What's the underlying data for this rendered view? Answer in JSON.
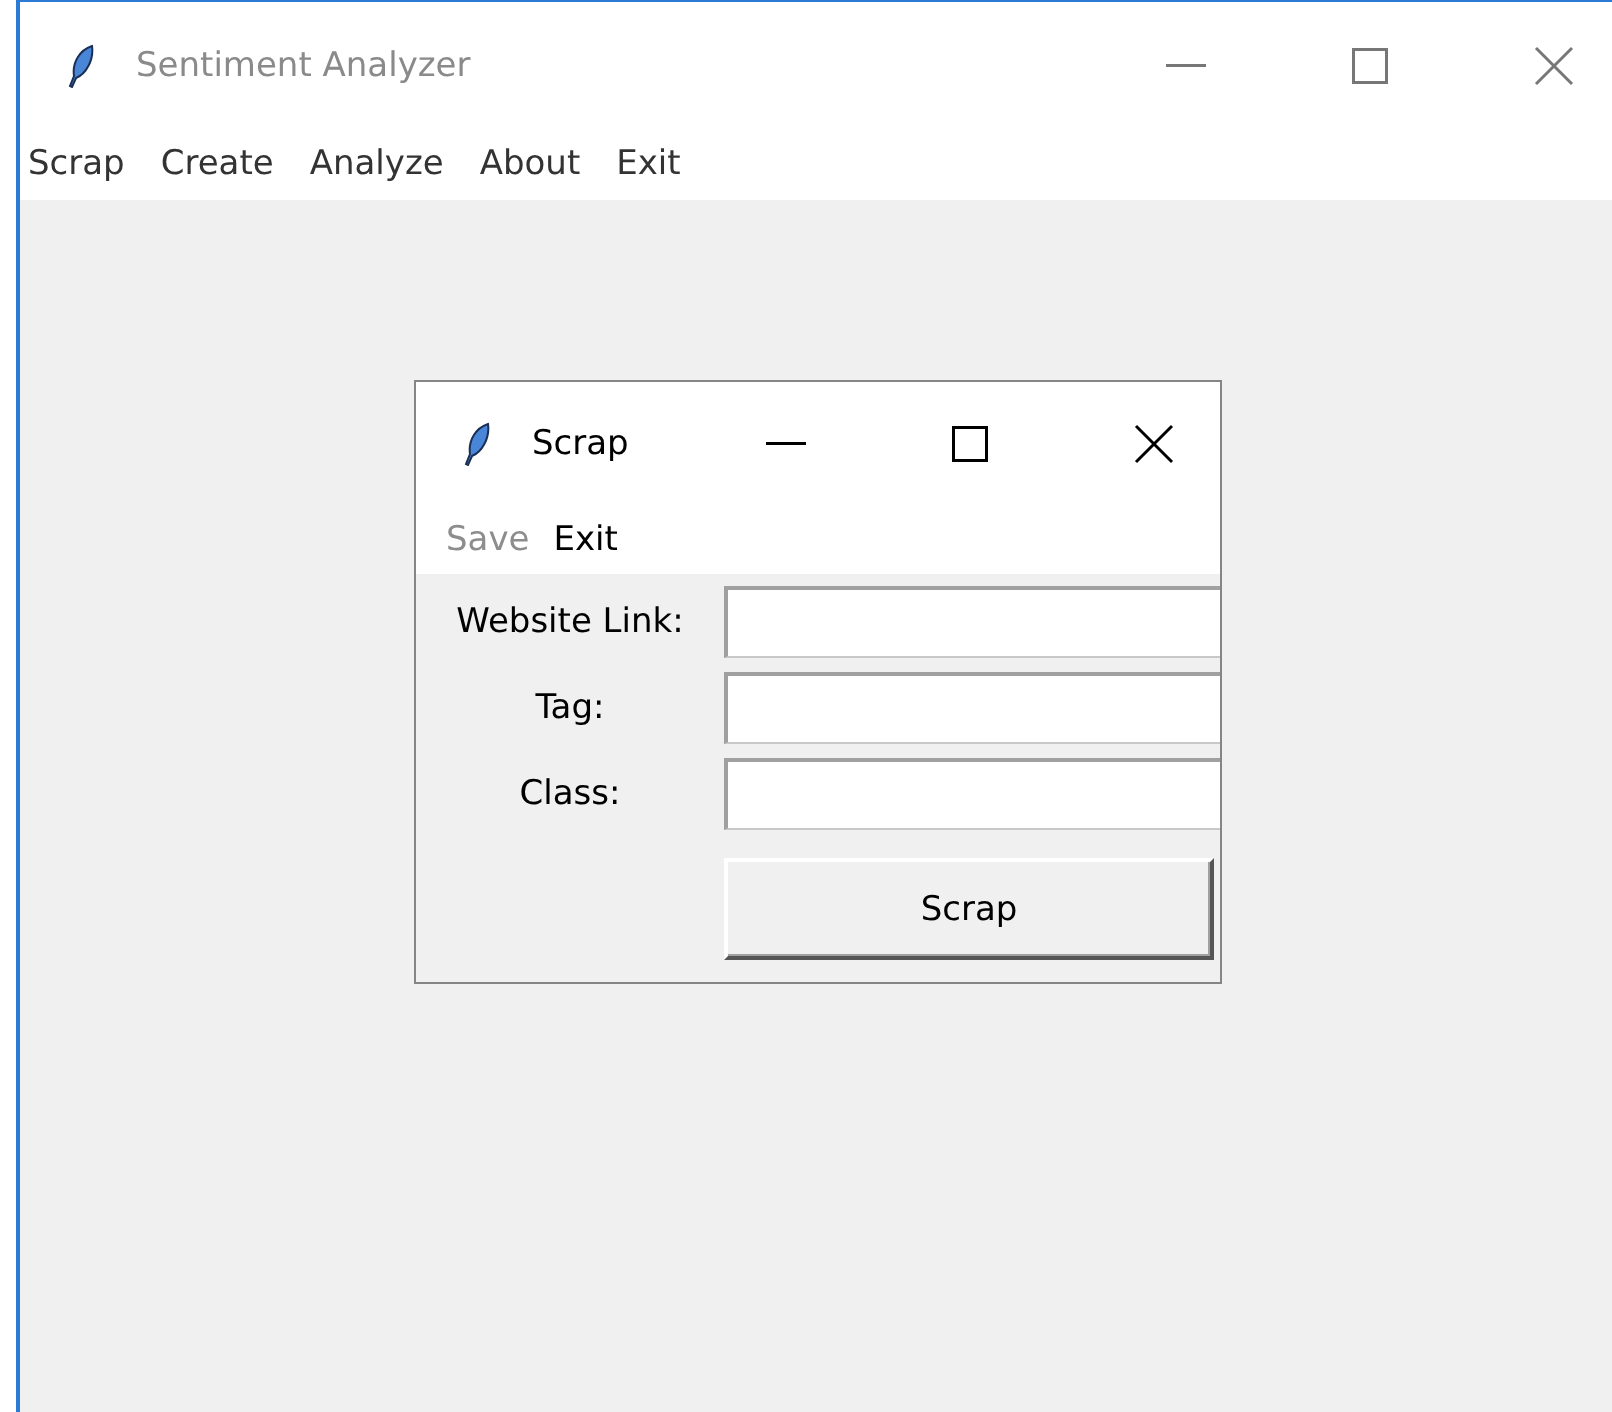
{
  "main_window": {
    "title": "Sentiment Analyzer",
    "active": false,
    "menu": [
      {
        "label": "Scrap"
      },
      {
        "label": "Create"
      },
      {
        "label": "Analyze"
      },
      {
        "label": "About"
      },
      {
        "label": "Exit"
      }
    ]
  },
  "dialog": {
    "title": "Scrap",
    "active": true,
    "menu": [
      {
        "label": "Save",
        "disabled": true
      },
      {
        "label": "Exit",
        "disabled": false
      }
    ],
    "fields": [
      {
        "label": "Website Link:"
      },
      {
        "label": "Tag:"
      },
      {
        "label": "Class:"
      }
    ],
    "button": "Scrap"
  }
}
